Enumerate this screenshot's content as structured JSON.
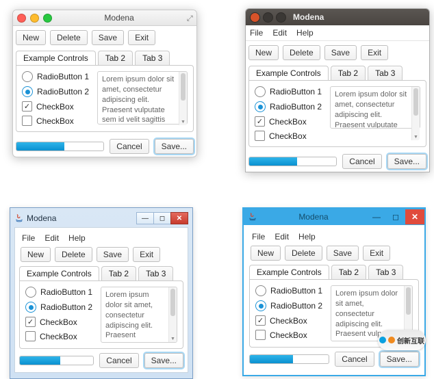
{
  "window_title": "Modena",
  "menu": {
    "file": "File",
    "edit": "Edit",
    "help": "Help"
  },
  "toolbar": {
    "new": "New",
    "delete": "Delete",
    "save": "Save",
    "exit": "Exit"
  },
  "tabs": {
    "t1": "Example Controls",
    "t2": "Tab 2",
    "t3": "Tab 3"
  },
  "controls": {
    "radio1": "RadioButton 1",
    "radio2": "RadioButton 2",
    "check1": "CheckBox",
    "check2": "CheckBox"
  },
  "textarea_mac": "Lorem ipsum dolor sit amet, consectetur adipiscing elit. Praesent vulputate sem id velit sagittis quis imperdiet",
  "textarea_ubu": "Lorem ipsum dolor sit amet, consectetur adipiscing elit. Praesent vulputate",
  "textarea_win": "Lorem ipsum dolor sit amet, consectetur adipiscing elit. Praesent vulputate sem id velit sagittis quis imperdiet nunc imperdiet. Etiam",
  "textarea_w8": "Lorem ipsum dolor sit amet, consectetur adipiscing elit. Praesent vulputate sem id velit sagittis quis imperdiet nunc imperdiet",
  "bottom": {
    "cancel": "Cancel",
    "save": "Save..."
  },
  "badge": {
    "text": "创新互联"
  },
  "progress_pct": 55
}
